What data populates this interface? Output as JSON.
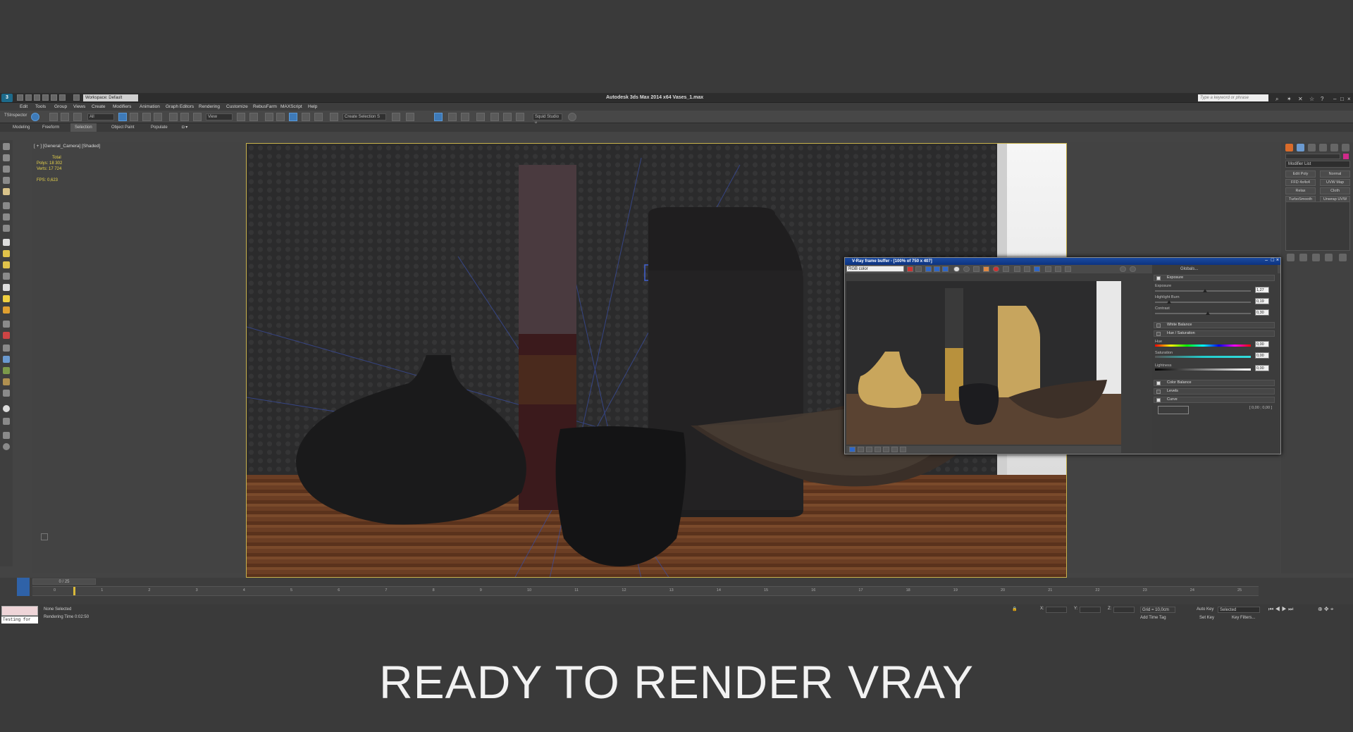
{
  "app": {
    "title": "Autodesk 3ds Max  2014 x64     Vases_1.max",
    "workspace": "Workspace: Default",
    "keyword_placeholder": "Type a keyword or phrase",
    "menu": [
      "Edit",
      "Tools",
      "Group",
      "Views",
      "Create",
      "Modifiers",
      "Animation",
      "Graph Editors",
      "Rendering",
      "Customize",
      "RebusFarm",
      "MAXScript",
      "Help"
    ]
  },
  "toolbar": {
    "inspector": "TSInspector",
    "filter_drop": "All",
    "ref_coord_drop": "View",
    "selection_set": "Create Selection S",
    "squid": "Squid Studio v"
  },
  "ribbon": {
    "tabs": [
      "Modeling",
      "Freeform",
      "Selection",
      "Object Paint",
      "Populate"
    ],
    "selected": "Selection"
  },
  "viewport": {
    "label": "[ + ] [General_Camera] [Shaded]",
    "stats": {
      "total_label": "Total",
      "polys": "Polys:   18 302",
      "verts": "Verts:   17 724",
      "fps": "FPS:    0,623"
    }
  },
  "vfb": {
    "title": "V-Ray frame buffer - [100% of 750 x 407]",
    "channel": "RGB color",
    "globals": "Globals...",
    "exposure_section": "Exposure",
    "exposure_label": "Exposure",
    "exposure_value": "1,27",
    "exposure_level": 0.52,
    "highlight_label": "Highlight Burn",
    "highlight_value": "0,19",
    "highlight_level": 0.15,
    "contrast_label": "Contrast",
    "contrast_value": "0,30",
    "contrast_level": 0.55,
    "white_balance": "White Balance",
    "hue_section": "Hue / Saturation",
    "hue_label": "Hue",
    "hue_value": "0,00",
    "saturation_label": "Saturation",
    "saturation_value": "0,00",
    "lightness_label": "Lightness",
    "lightness_value": "0,00",
    "color_balance": "Color Balance",
    "levels": "Levels",
    "curve": "Curve",
    "curve_coords": "[ 0,00 ; 0,00 ]"
  },
  "command_panel": {
    "modifier_list": "Modifier List",
    "buttons": [
      "Edit Poly",
      "Normal",
      "FFD 4x4x4",
      "UVW Map",
      "Relax",
      "Cloth",
      "TurboSmooth",
      "Unwrap UVW"
    ]
  },
  "timeline": {
    "frame": "0 / 25",
    "ticks": [
      "0",
      "1",
      "2",
      "3",
      "4",
      "5",
      "6",
      "7",
      "8",
      "9",
      "10",
      "11",
      "12",
      "13",
      "14",
      "15",
      "16",
      "17",
      "18",
      "19",
      "20",
      "21",
      "22",
      "23",
      "24",
      "25"
    ]
  },
  "status": {
    "script_text": "Testing for",
    "selection": "None Selected",
    "render_time": "Rendering Time  0:02:50",
    "x_label": "X:",
    "y_label": "Y:",
    "z_label": "Z:",
    "grid": "Grid = 10,0cm",
    "auto_key": "Auto Key",
    "auto_key_mode": "Selected",
    "set_key": "Set Key",
    "key_filters": "Key Filters...",
    "add_time_tag": "Add Time Tag"
  },
  "caption": "READY TO RENDER  VRAY",
  "colors": {
    "viewport_border": "#c9b24c",
    "vfb_title": "#1a4aa0",
    "stats_text": "#e8d44a"
  }
}
